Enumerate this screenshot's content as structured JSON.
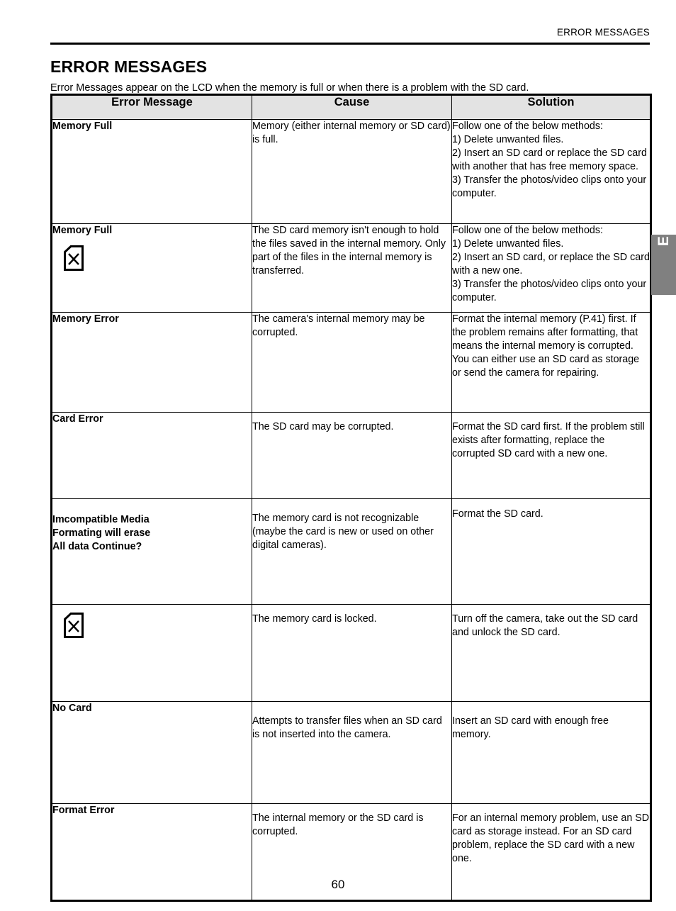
{
  "running_head": "ERROR MESSAGES",
  "section_title": "ERROR MESSAGES",
  "intro": "Error Messages appear on the LCD when the memory is full or when there is a problem with the SD card.",
  "language_tab": "ENU",
  "page_number": "60",
  "colors": {
    "header_fill": "#e3e3e3",
    "tab_fill": "#808080",
    "tab_text": "#ffffff",
    "rule": "#000000"
  },
  "table": {
    "headers": [
      "Error Message",
      "Cause",
      "Solution"
    ],
    "rows": [
      {
        "message_lines": [
          "Memory Full"
        ],
        "icon": null,
        "cause": "Memory (either internal memory or SD card) is full.",
        "solution": "Follow one of the below methods:\n1) Delete unwanted files.\n2) Insert an SD card or replace the SD card with another that has free memory space.\n3) Transfer the photos/video clips onto your computer."
      },
      {
        "message_lines": [
          "Memory Full"
        ],
        "icon": "sd-card-error-icon",
        "cause": "The SD card memory isn't enough to hold the files saved in the internal memory. Only part of the files in the internal memory is transferred.",
        "solution": "Follow one of the below methods:\n1) Delete unwanted files.\n2) Insert an SD card, or replace the SD card with a new one.\n3) Transfer the photos/video clips onto your computer."
      },
      {
        "message_lines": [
          "Memory Error"
        ],
        "icon": null,
        "cause": "The camera's internal memory may be corrupted.",
        "solution": "Format the internal memory (P.41) first. If the problem remains after formatting, that means the internal memory is corrupted. You can either use an SD card as storage or send the camera for repairing."
      },
      {
        "message_lines": [
          "Card Error"
        ],
        "icon": null,
        "cause": "The SD card may be corrupted.",
        "solution": "Format the SD card first. If the problem still exists after formatting, replace the corrupted SD card with a new one."
      },
      {
        "message_lines": [
          "Imcompatible Media",
          "Formating will erase",
          "All data Continue?"
        ],
        "icon": null,
        "cause": "The memory card is not recognizable (maybe the card is new or used on other digital cameras).",
        "solution": "Format the SD card."
      },
      {
        "message_lines": [],
        "icon": "sd-card-error-icon",
        "cause": "The memory card is locked.",
        "solution": "Turn off the camera, take out the SD card and unlock the SD card."
      },
      {
        "message_lines": [
          "No Card"
        ],
        "icon": null,
        "cause": "Attempts to transfer files when an SD card is not inserted into the camera.",
        "solution": "Insert an SD card with enough free memory."
      },
      {
        "message_lines": [
          "Format Error"
        ],
        "icon": null,
        "cause": "The internal memory or the SD card is corrupted.",
        "solution": "For an internal memory problem, use an SD card as storage instead. For an SD card problem, replace the SD card with a new one."
      }
    ]
  }
}
